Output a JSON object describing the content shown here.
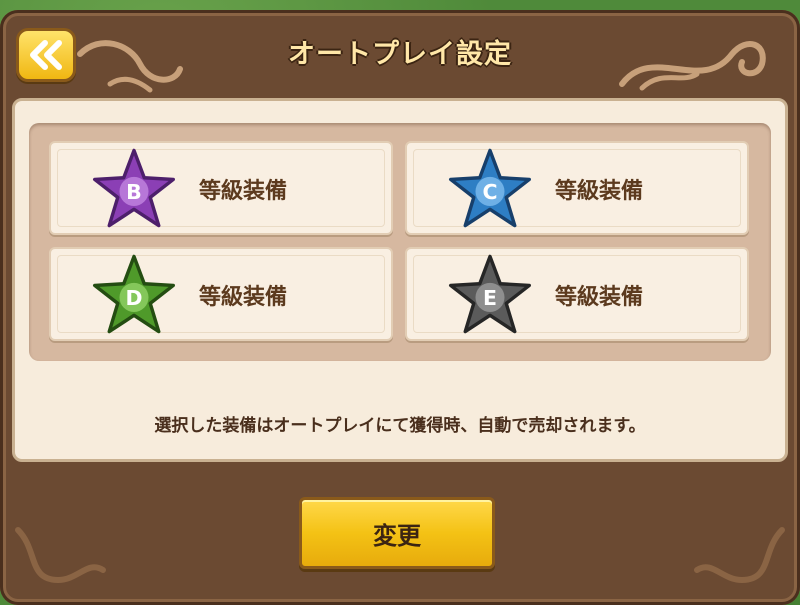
{
  "header": {
    "title": "オートプレイ設定"
  },
  "grades": [
    {
      "letter": "B",
      "label": "等級装備",
      "color": "#8b3fb5"
    },
    {
      "letter": "C",
      "label": "等級装備",
      "color": "#2e7ec4"
    },
    {
      "letter": "D",
      "label": "等級装備",
      "color": "#4f9a2a"
    },
    {
      "letter": "E",
      "label": "等級装備",
      "color": "#5b5b5b"
    }
  ],
  "note": "選択した装備はオートプレイにて獲得時、自動で売却されます。",
  "footer": {
    "change_label": "変更"
  }
}
